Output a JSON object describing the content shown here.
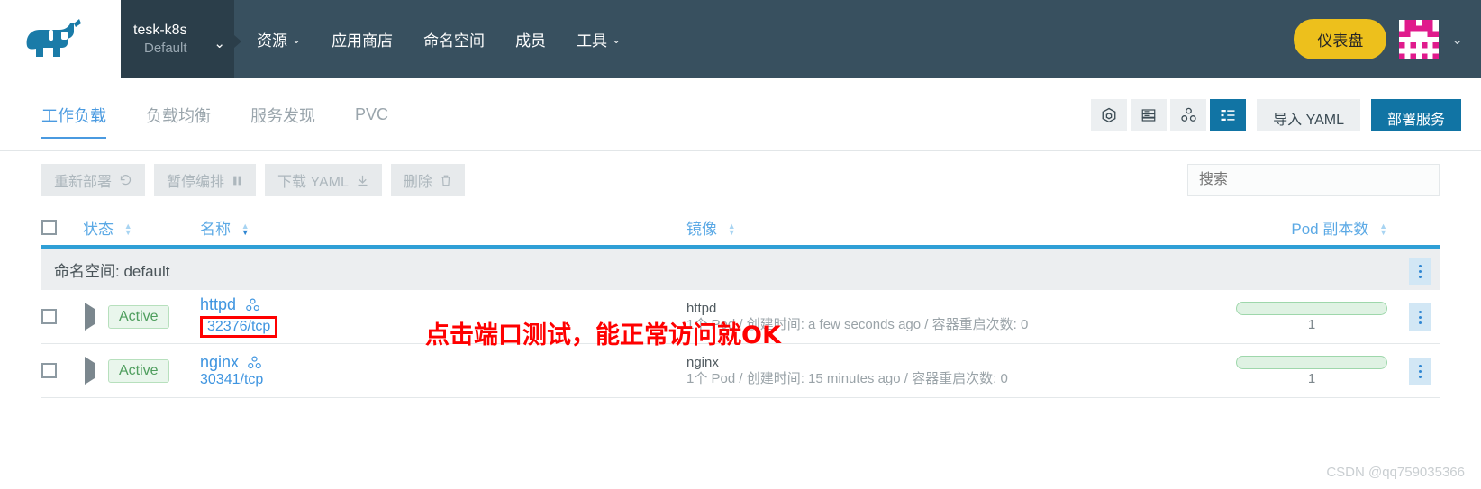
{
  "header": {
    "logo_icon": "rancher-cow-logo",
    "project": {
      "name": "tesk-k8s",
      "sub": "Default",
      "caret_icon": "chevron-down-icon"
    },
    "nav": [
      {
        "label": "资源",
        "has_caret": true
      },
      {
        "label": "应用商店",
        "has_caret": false
      },
      {
        "label": "命名空间",
        "has_caret": false
      },
      {
        "label": "成员",
        "has_caret": false
      },
      {
        "label": "工具",
        "has_caret": true
      }
    ],
    "dashboard_button": "仪表盘",
    "avatar_icon": "user-identicon-avatar",
    "avatar_caret_icon": "chevron-down-icon",
    "accent_yellow": "#edc01c",
    "avatar_pink": "#e01a8c",
    "bg": "#38505f"
  },
  "tabs": [
    {
      "label": "工作负载",
      "active": true
    },
    {
      "label": "负载均衡",
      "active": false
    },
    {
      "label": "服务发现",
      "active": false
    },
    {
      "label": "PVC",
      "active": false
    }
  ],
  "view_buttons": [
    {
      "icon": "cube-icon",
      "active": false
    },
    {
      "icon": "server-stack-icon",
      "active": false
    },
    {
      "icon": "cluster-nodes-icon",
      "active": false
    },
    {
      "icon": "list-view-icon",
      "active": true
    }
  ],
  "toolbar": {
    "import_yaml": "导入 YAML",
    "deploy_service": "部署服务",
    "accent_blue": "#1174a4"
  },
  "actions": [
    {
      "label": "重新部署",
      "icon": "redeploy-icon",
      "disabled": true
    },
    {
      "label": "暂停编排",
      "icon": "pause-icon",
      "disabled": true
    },
    {
      "label": "下载 YAML",
      "icon": "download-icon",
      "disabled": true
    },
    {
      "label": "删除",
      "icon": "trash-icon",
      "disabled": true
    }
  ],
  "search": {
    "placeholder": "搜索",
    "value": ""
  },
  "table": {
    "columns": {
      "state": "状态",
      "name": "名称",
      "image": "镜像",
      "pod_scale": "Pod 副本数"
    },
    "group_label": "命名空间: default",
    "rows": [
      {
        "state": "Active",
        "name": "httpd",
        "name_icon": "cluster-nodes-icon",
        "port": "32376/tcp",
        "port_highlighted": true,
        "image_name": "httpd",
        "image_meta": "1个 Pod / 创建时间: a few seconds ago / 容器重启次数: 0",
        "pod_count": "1"
      },
      {
        "state": "Active",
        "name": "nginx",
        "name_icon": "cluster-nodes-icon",
        "port": "30341/tcp",
        "port_highlighted": false,
        "image_name": "nginx",
        "image_meta": "1个 Pod / 创建时间: 15 minutes ago / 容器重启次数: 0",
        "pod_count": "1"
      }
    ]
  },
  "annotation": {
    "text": "点击端口测试，能正常访问就OK",
    "color": "#ff0000"
  },
  "watermark": "CSDN @qq759035366"
}
